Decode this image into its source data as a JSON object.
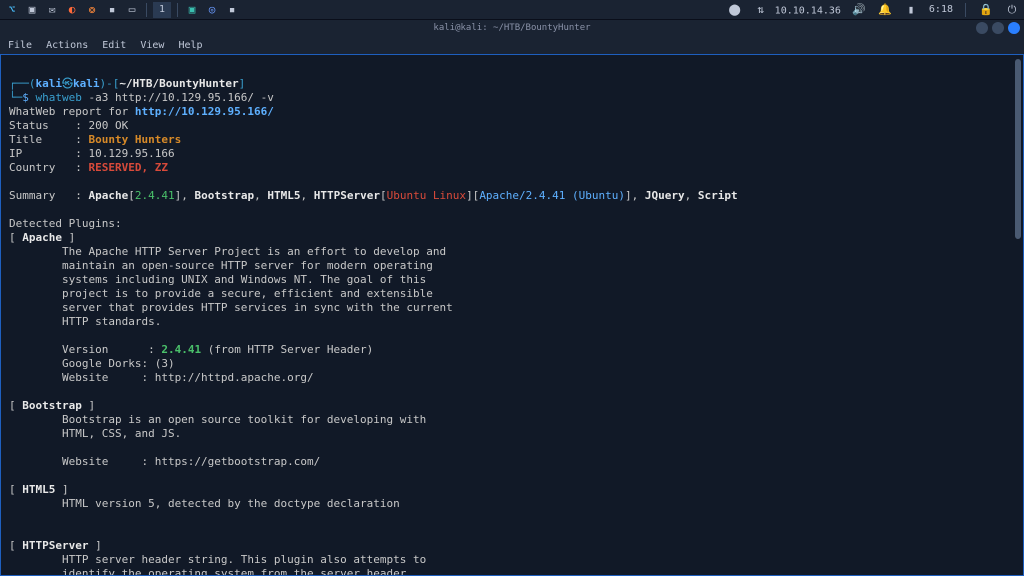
{
  "taskbar": {
    "workspace": "1",
    "ip": "10.10.14.36",
    "time": "6:18"
  },
  "window": {
    "title": "kali@kali: ~/HTB/BountyHunter"
  },
  "menubar": {
    "file": "File",
    "actions": "Actions",
    "edit": "Edit",
    "view": "View",
    "help": "Help"
  },
  "prompt": {
    "open_paren": "┌──(",
    "user": "kali",
    "at": "㉿",
    "host": "kali",
    "close_user": ")",
    "dash_open": "-[",
    "cwd": "~/HTB/BountyHunter",
    "close_bracket": "]",
    "line2_prefix": "└─",
    "dollar": "$"
  },
  "cmd": {
    "bin": "whatweb",
    "args": " -a3 http://10.129.95.166/ -v"
  },
  "report": {
    "line": "WhatWeb report for ",
    "url": "http://10.129.95.166/",
    "status_label": "Status    : ",
    "status_value": "200 OK",
    "title_label": "Title     : ",
    "title_value": "Bounty Hunters",
    "ip_label": "IP        : ",
    "ip_value": "10.129.95.166",
    "country_label": "Country   : ",
    "country_value": "RESERVED, ZZ",
    "summary_label": "Summary   : ",
    "summary_apache": "Apache",
    "summary_apache_open": "[",
    "summary_apache_ver": "2.4.41",
    "summary_apache_close": "]",
    "summary_sep1": ", ",
    "summary_bootstrap": "Bootstrap",
    "summary_sep2": ", ",
    "summary_html5": "HTML5",
    "summary_sep3": ", ",
    "summary_httpserver": "HTTPServer",
    "summary_hs_open": "[",
    "summary_hs_os": "Ubuntu Linux",
    "summary_hs_mid": "][",
    "summary_hs_srv": "Apache/2.4.41 (Ubuntu)",
    "summary_hs_close": "]",
    "summary_sep4": ", ",
    "summary_jquery": "JQuery",
    "summary_sep5": ", ",
    "summary_script": "Script",
    "detected": "Detected Plugins:"
  },
  "plugins": {
    "apache": {
      "head_open": "[ ",
      "name": "Apache",
      "head_close": " ]",
      "d1": "        The Apache HTTP Server Project is an effort to develop and",
      "d2": "        maintain an open-source HTTP server for modern operating",
      "d3": "        systems including UNIX and Windows NT. The goal of this",
      "d4": "        project is to provide a secure, efficient and extensible",
      "d5": "        server that provides HTTP services in sync with the current",
      "d6": "        HTTP standards.",
      "ver_label": "        Version      : ",
      "ver_value": "2.4.41",
      "ver_suffix": " (from HTTP Server Header)",
      "dorks": "        Google Dorks: (3)",
      "site": "        Website     : http://httpd.apache.org/"
    },
    "bootstrap": {
      "head_open": "[ ",
      "name": "Bootstrap",
      "head_close": " ]",
      "d1": "        Bootstrap is an open source toolkit for developing with",
      "d2": "        HTML, CSS, and JS.",
      "site": "        Website     : https://getbootstrap.com/"
    },
    "html5": {
      "head_open": "[ ",
      "name": "HTML5",
      "head_close": " ]",
      "d1": "        HTML version 5, detected by the doctype declaration"
    },
    "httpserver": {
      "head_open": "[ ",
      "name": "HTTPServer",
      "head_close": " ]",
      "d1": "        HTTP server header string. This plugin also attempts to",
      "d2": "        identify the operating system from the server header."
    }
  }
}
